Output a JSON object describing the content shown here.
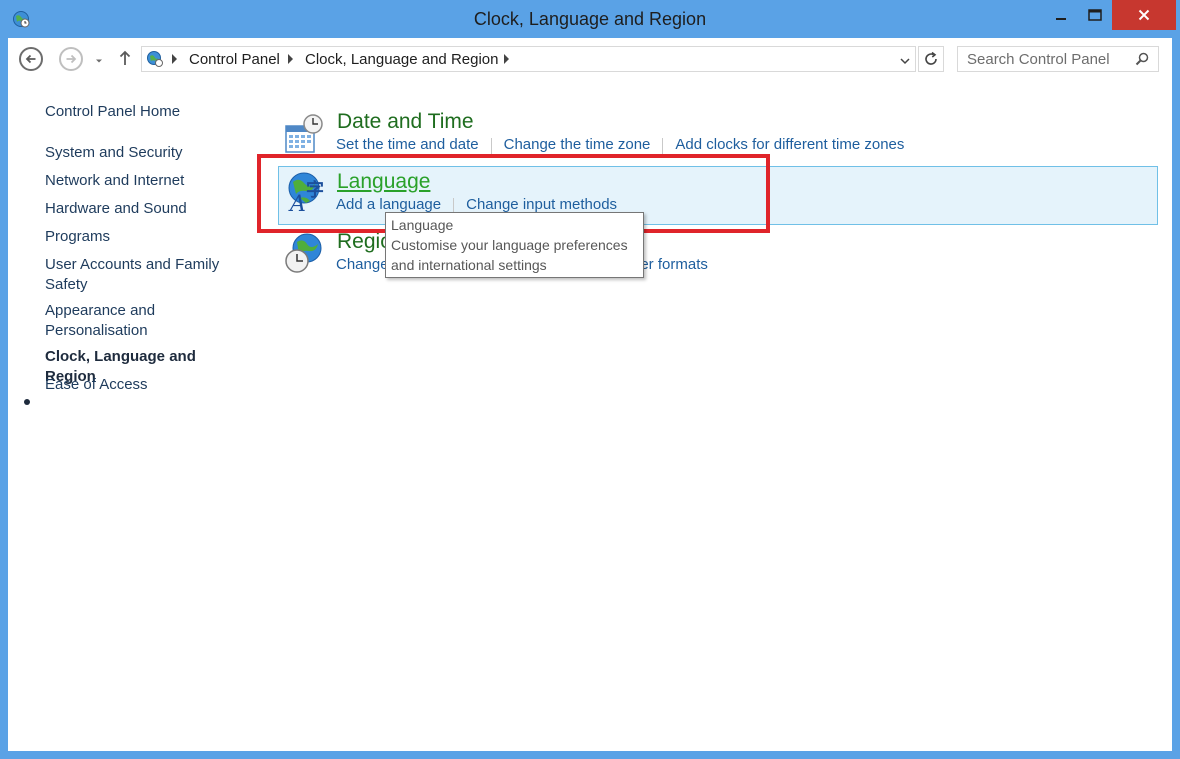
{
  "window": {
    "title": "Clock, Language and Region"
  },
  "nav": {
    "breadcrumb": [
      "Control Panel",
      "Clock, Language and Region"
    ],
    "search_placeholder": "Search Control Panel"
  },
  "sidebar": {
    "home": "Control Panel Home",
    "items": [
      "System and Security",
      "Network and Internet",
      "Hardware and Sound",
      "Programs",
      "User Accounts and Family Safety",
      "Appearance and Personalisation",
      "Clock, Language and Region",
      "Ease of Access"
    ],
    "current": "Clock, Language and Region"
  },
  "categories": [
    {
      "title": "Date and Time",
      "icon": "calendar-clock-icon",
      "links": [
        "Set the time and date",
        "Change the time zone",
        "Add clocks for different time zones"
      ]
    },
    {
      "title": "Language",
      "icon": "language-globe-icon",
      "links": [
        "Add a language",
        "Change input methods"
      ]
    },
    {
      "title": "Regio",
      "icon": "region-globe-clock-icon",
      "links": [
        "Change",
        "per formats"
      ]
    }
  ],
  "tooltip": {
    "title": "Language",
    "line1": "Customise your language preferences",
    "line2": "and international settings"
  },
  "colors": {
    "frame": "#5aa2e6",
    "category_title": "#1f6d1f",
    "link": "#1e5e9e",
    "highlight_bg": "#e5f3fb",
    "highlight_border": "#70c0e7",
    "annotation_red": "#e0242a",
    "close_button": "#c7372f"
  }
}
